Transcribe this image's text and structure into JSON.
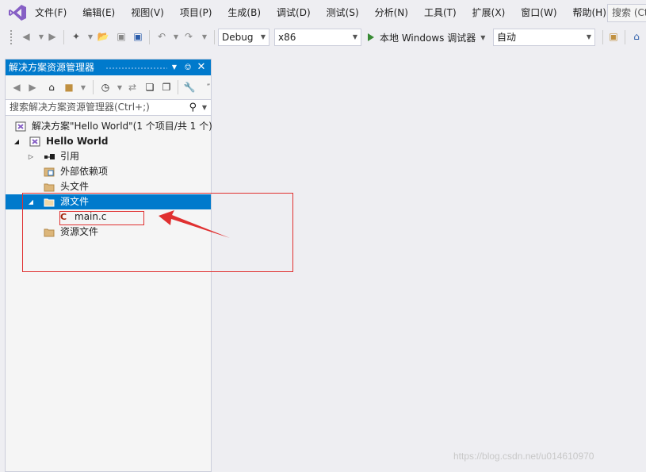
{
  "menu": {
    "items": [
      "文件(F)",
      "编辑(E)",
      "视图(V)",
      "项目(P)",
      "生成(B)",
      "调试(D)",
      "测试(S)",
      "分析(N)",
      "工具(T)",
      "扩展(X)",
      "窗口(W)",
      "帮助(H)"
    ],
    "search_placeholder": "搜索 (Ct"
  },
  "toolbar": {
    "configuration": "Debug",
    "platform": "x86",
    "run_label": "本地 Windows 调试器",
    "auto_combo": "自动"
  },
  "solution_explorer": {
    "title": "解决方案资源管理器",
    "search_placeholder": "搜索解决方案资源管理器(Ctrl+;)",
    "tree": {
      "solution": "解决方案\"Hello World\"(1 个项目/共 1 个)",
      "project": "Hello World",
      "references": "引用",
      "external_deps": "外部依赖项",
      "header_files": "头文件",
      "source_files": "源文件",
      "main_file": "main.c",
      "resource_files": "资源文件"
    }
  },
  "colors": {
    "accent": "#007acc",
    "annotation": "#e03030",
    "run": "#388a34"
  },
  "watermark": "https://blog.csdn.net/u014610970"
}
